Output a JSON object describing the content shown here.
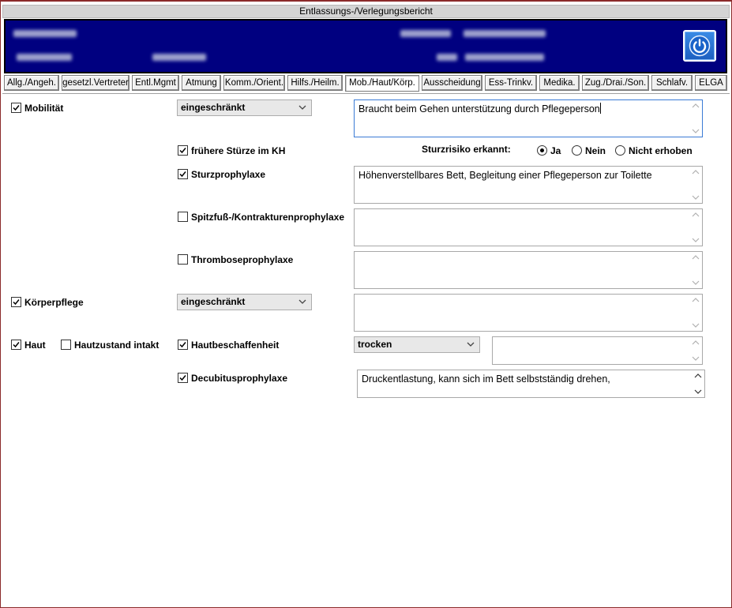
{
  "window": {
    "title": "Entlassungs-/Verlegungsbericht"
  },
  "header": {
    "power_button": "power-icon"
  },
  "tabs": [
    "Allg./Angeh.",
    "gesetzl.Vertreter",
    "Entl.Mgmt",
    "Atmung",
    "Komm./Orient.",
    "Hilfs./Heilm.",
    "Mob./Haut/Körp.",
    "Ausscheidung",
    "Ess-Trinkv.",
    "Medika.",
    "Zug./Drai./Son.",
    "Schlafv.",
    "ELGA"
  ],
  "active_tab": "Mob./Haut/Körp.",
  "form": {
    "mobilitaet": {
      "label": "Mobilität",
      "checked": true,
      "select_value": "eingeschränkt",
      "note": "Braucht beim Gehen unterstützung durch Pflegeperson"
    },
    "fruehere_stuerze": {
      "label": "frühere Stürze im KH",
      "checked": true
    },
    "sturzrisiko": {
      "label": "Sturzrisiko erkannt:",
      "options": [
        "Ja",
        "Nein",
        "Nicht erhoben"
      ],
      "selected": "Ja"
    },
    "sturzprophylaxe": {
      "label": "Sturzprophylaxe",
      "checked": true,
      "note": "Höhenverstellbares Bett, Begleitung einer Pflegeperson zur Toilette"
    },
    "spitzfuss": {
      "label": "Spitzfuß-/Kontrakturenprophylaxe",
      "checked": false,
      "note": ""
    },
    "thrombose": {
      "label": "Thromboseprophylaxe",
      "checked": false,
      "note": ""
    },
    "koerperpflege": {
      "label": "Körperpflege",
      "checked": true,
      "select_value": "eingeschränkt",
      "note": ""
    },
    "haut": {
      "label": "Haut",
      "checked": true
    },
    "hautzustand": {
      "label": "Hautzustand intakt",
      "checked": false
    },
    "hautbeschaffenheit": {
      "label": "Hautbeschaffenheit",
      "checked": true,
      "select_value": "trocken",
      "note": ""
    },
    "decubitus": {
      "label": "Decubitusprophylaxe",
      "checked": true,
      "note": "Druckentlastung, kann sich im Bett selbstständig drehen,"
    }
  }
}
